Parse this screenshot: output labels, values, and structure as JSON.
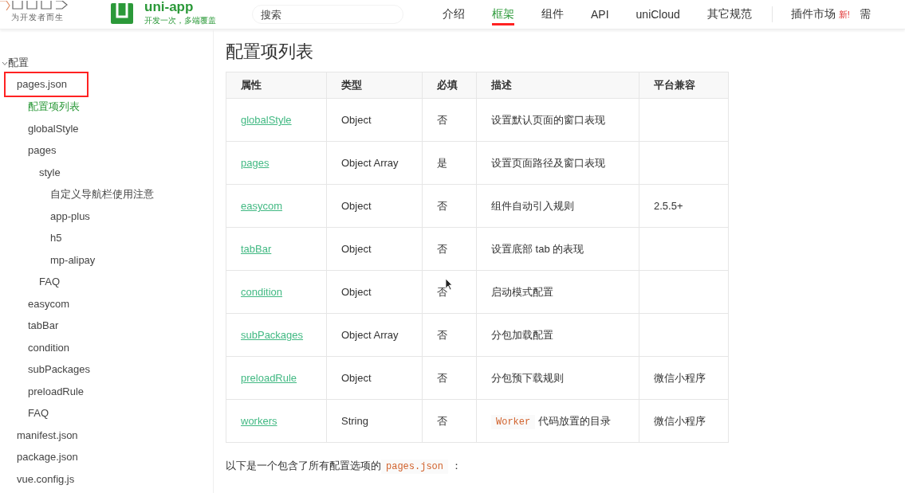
{
  "header": {
    "brand_tagline": "为开发者而生",
    "product_name": "uni-app",
    "product_slogan": "开发一次，多端覆盖",
    "search": {
      "placeholder": "搜索"
    },
    "nav": [
      {
        "label": "介绍",
        "selected": false
      },
      {
        "label": "框架",
        "selected": true
      },
      {
        "label": "组件",
        "selected": false
      },
      {
        "label": "API",
        "selected": false
      },
      {
        "label": "uniCloud",
        "selected": false
      },
      {
        "label": "其它规范",
        "selected": false
      }
    ],
    "plugin_market": {
      "label": "插件市场",
      "badge": "新!"
    },
    "nav_cut": "需"
  },
  "sidebar": {
    "items": [
      {
        "label": "配置",
        "selected": false,
        "boxed": false,
        "expanded": true,
        "children": [
          {
            "label": "pages.json",
            "selected": false,
            "boxed": true,
            "children": [
              {
                "label": "配置项列表",
                "selected": true,
                "boxed": false
              },
              {
                "label": "globalStyle",
                "selected": false,
                "boxed": false
              },
              {
                "label": "pages",
                "selected": false,
                "boxed": false,
                "children": [
                  {
                    "label": "style",
                    "selected": false,
                    "boxed": false,
                    "children": [
                      {
                        "label": "自定义导航栏使用注意",
                        "selected": false,
                        "boxed": false
                      },
                      {
                        "label": "app-plus",
                        "selected": false,
                        "boxed": false
                      },
                      {
                        "label": "h5",
                        "selected": false,
                        "boxed": false
                      },
                      {
                        "label": "mp-alipay",
                        "selected": false,
                        "boxed": false
                      }
                    ]
                  },
                  {
                    "label": "FAQ",
                    "selected": false,
                    "boxed": false
                  }
                ]
              },
              {
                "label": "easycom",
                "selected": false,
                "boxed": false
              },
              {
                "label": "tabBar",
                "selected": false,
                "boxed": false
              },
              {
                "label": "condition",
                "selected": false,
                "boxed": false
              },
              {
                "label": "subPackages",
                "selected": false,
                "boxed": false
              },
              {
                "label": "preloadRule",
                "selected": false,
                "boxed": false
              },
              {
                "label": "FAQ",
                "selected": false,
                "boxed": false
              }
            ]
          },
          {
            "label": "manifest.json",
            "selected": false,
            "boxed": false
          },
          {
            "label": "package.json",
            "selected": false,
            "boxed": false
          },
          {
            "label": "vue.config.js",
            "selected": false,
            "boxed": false
          }
        ]
      }
    ]
  },
  "content": {
    "title": "配置项列表",
    "table": {
      "columns": [
        "属性",
        "类型",
        "必填",
        "描述",
        "平台兼容"
      ],
      "rows": [
        {
          "property": "globalStyle",
          "type": "Object",
          "required": "否",
          "description": "设置默认页面的窗口表现"
        },
        {
          "property": "pages",
          "type": "Object Array",
          "required": "是",
          "description": "设置页面路径及窗口表现"
        },
        {
          "property": "easycom",
          "type": "Object",
          "required": "否",
          "description": "组件自动引入规则",
          "platform": "2.5.5+"
        },
        {
          "property": "tabBar",
          "type": "Object",
          "required": "否",
          "description": "设置底部 tab 的表现"
        },
        {
          "property": "condition",
          "type": "Object",
          "required": "否",
          "description": "启动模式配置"
        },
        {
          "property": "subPackages",
          "type": "Object Array",
          "required": "否",
          "description": "分包加载配置"
        },
        {
          "property": "preloadRule",
          "type": "Object",
          "required": "否",
          "description": "分包预下载规则",
          "platform": "微信小程序"
        },
        {
          "property": "workers",
          "type": "String",
          "required": "否",
          "description_code": "Worker",
          "description": "代码放置的目录",
          "platform": "微信小程序"
        }
      ]
    },
    "note": {
      "text": "以下是一个包含了所有配置选项的",
      "code": "pages.json",
      "tail": "："
    }
  }
}
